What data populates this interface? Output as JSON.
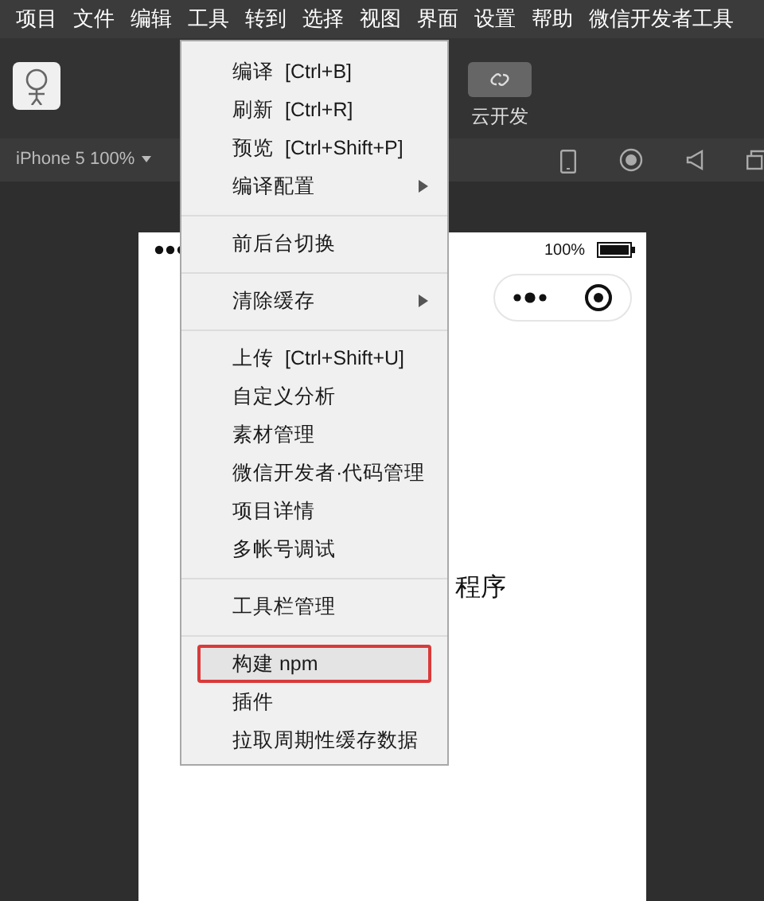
{
  "menu_bar": [
    {
      "label": "项目"
    },
    {
      "label": "文件"
    },
    {
      "label": "编辑"
    },
    {
      "label": "工具"
    },
    {
      "label": "转到"
    },
    {
      "label": "选择"
    },
    {
      "label": "视图"
    },
    {
      "label": "界面"
    },
    {
      "label": "设置"
    },
    {
      "label": "帮助"
    },
    {
      "label": "微信开发者工具"
    }
  ],
  "toolbar": {
    "cloud_button": {
      "label": "云开发"
    }
  },
  "simulator_bar": {
    "device": "iPhone 5 100%"
  },
  "phone": {
    "battery": "100%",
    "title": "程序"
  },
  "tools_menu": {
    "items": [
      {
        "kind": "item",
        "label": "编译",
        "shortcut": "[Ctrl+B]",
        "submenu": false,
        "highlighted": false
      },
      {
        "kind": "item",
        "label": "刷新",
        "shortcut": "[Ctrl+R]",
        "submenu": false,
        "highlighted": false
      },
      {
        "kind": "item",
        "label": "预览",
        "shortcut": "[Ctrl+Shift+P]",
        "submenu": false,
        "highlighted": false
      },
      {
        "kind": "item",
        "label": "编译配置",
        "submenu": true,
        "highlighted": false
      },
      {
        "kind": "separator"
      },
      {
        "kind": "item",
        "label": "前后台切换",
        "submenu": false,
        "highlighted": false
      },
      {
        "kind": "separator"
      },
      {
        "kind": "item",
        "label": "清除缓存",
        "submenu": true,
        "highlighted": false
      },
      {
        "kind": "separator"
      },
      {
        "kind": "item",
        "label": "上传",
        "shortcut": "[Ctrl+Shift+U]",
        "submenu": false,
        "highlighted": false
      },
      {
        "kind": "item",
        "label": "自定义分析",
        "submenu": false,
        "highlighted": false
      },
      {
        "kind": "item",
        "label": "素材管理",
        "submenu": false,
        "highlighted": false
      },
      {
        "kind": "item",
        "label": "微信开发者·代码管理",
        "submenu": false,
        "highlighted": false
      },
      {
        "kind": "item",
        "label": "项目详情",
        "submenu": false,
        "highlighted": false
      },
      {
        "kind": "item",
        "label": "多帐号调试",
        "submenu": false,
        "highlighted": false
      },
      {
        "kind": "separator"
      },
      {
        "kind": "item",
        "label": "工具栏管理",
        "submenu": false,
        "highlighted": false
      },
      {
        "kind": "separator"
      },
      {
        "kind": "item",
        "label": "构建 npm",
        "submenu": false,
        "highlighted": true
      },
      {
        "kind": "item",
        "label": "插件",
        "submenu": false,
        "highlighted": false
      },
      {
        "kind": "item",
        "label": "拉取周期性缓存数据",
        "submenu": false,
        "highlighted": false
      }
    ]
  }
}
